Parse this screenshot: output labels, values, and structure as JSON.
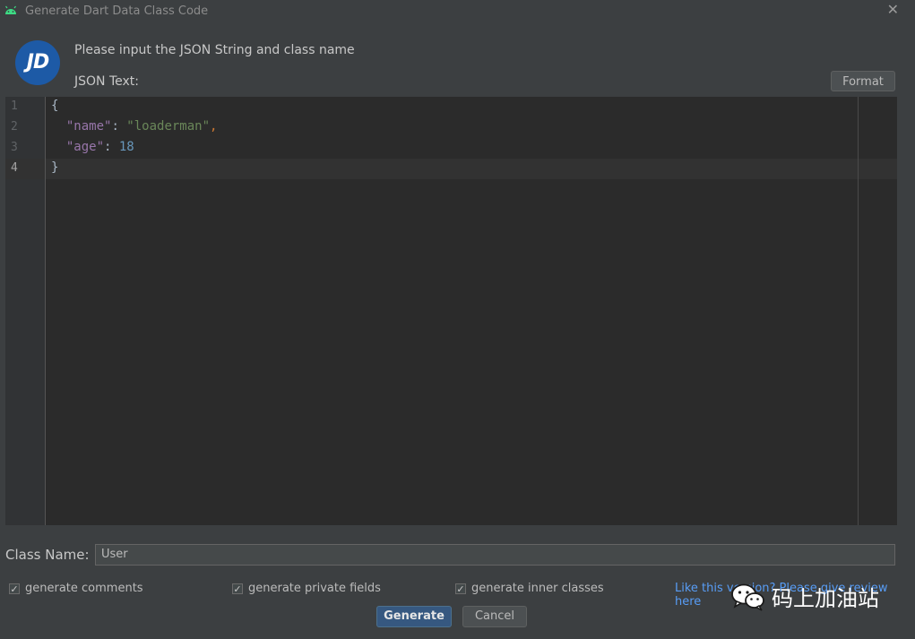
{
  "window": {
    "title": "Generate Dart Data Class Code",
    "close_glyph": "✕",
    "icon": "android-icon"
  },
  "header": {
    "logo_text": "JD",
    "prompt": "Please input the JSON String and class name",
    "json_label": "JSON Text:",
    "format_label": "Format"
  },
  "editor": {
    "line_numbers": [
      "1",
      "2",
      "3",
      "4"
    ],
    "current_line": 4,
    "lines": [
      "{",
      "  \"name\": \"loaderman\",",
      "  \"age\": 18",
      "}"
    ]
  },
  "class_name": {
    "label": "Class Name:",
    "value": "User"
  },
  "options": [
    {
      "label": "generate comments",
      "checked": true
    },
    {
      "label": "generate private fields",
      "checked": true
    },
    {
      "label": "generate inner classes",
      "checked": true
    }
  ],
  "review_link": "Like this version? Please give review here",
  "watermark": {
    "icon": "wechat-icon",
    "text": "码上加油站"
  },
  "buttons": {
    "generate": "Generate",
    "cancel": "Cancel"
  },
  "colors": {
    "background": "#3c3f41",
    "editor_bg": "#2b2b2b",
    "accent": "#365880",
    "link": "#589df6",
    "json_key": "#9876aa",
    "json_string": "#6a8759",
    "json_number": "#6897bb",
    "logo": "#1d5aa6"
  }
}
